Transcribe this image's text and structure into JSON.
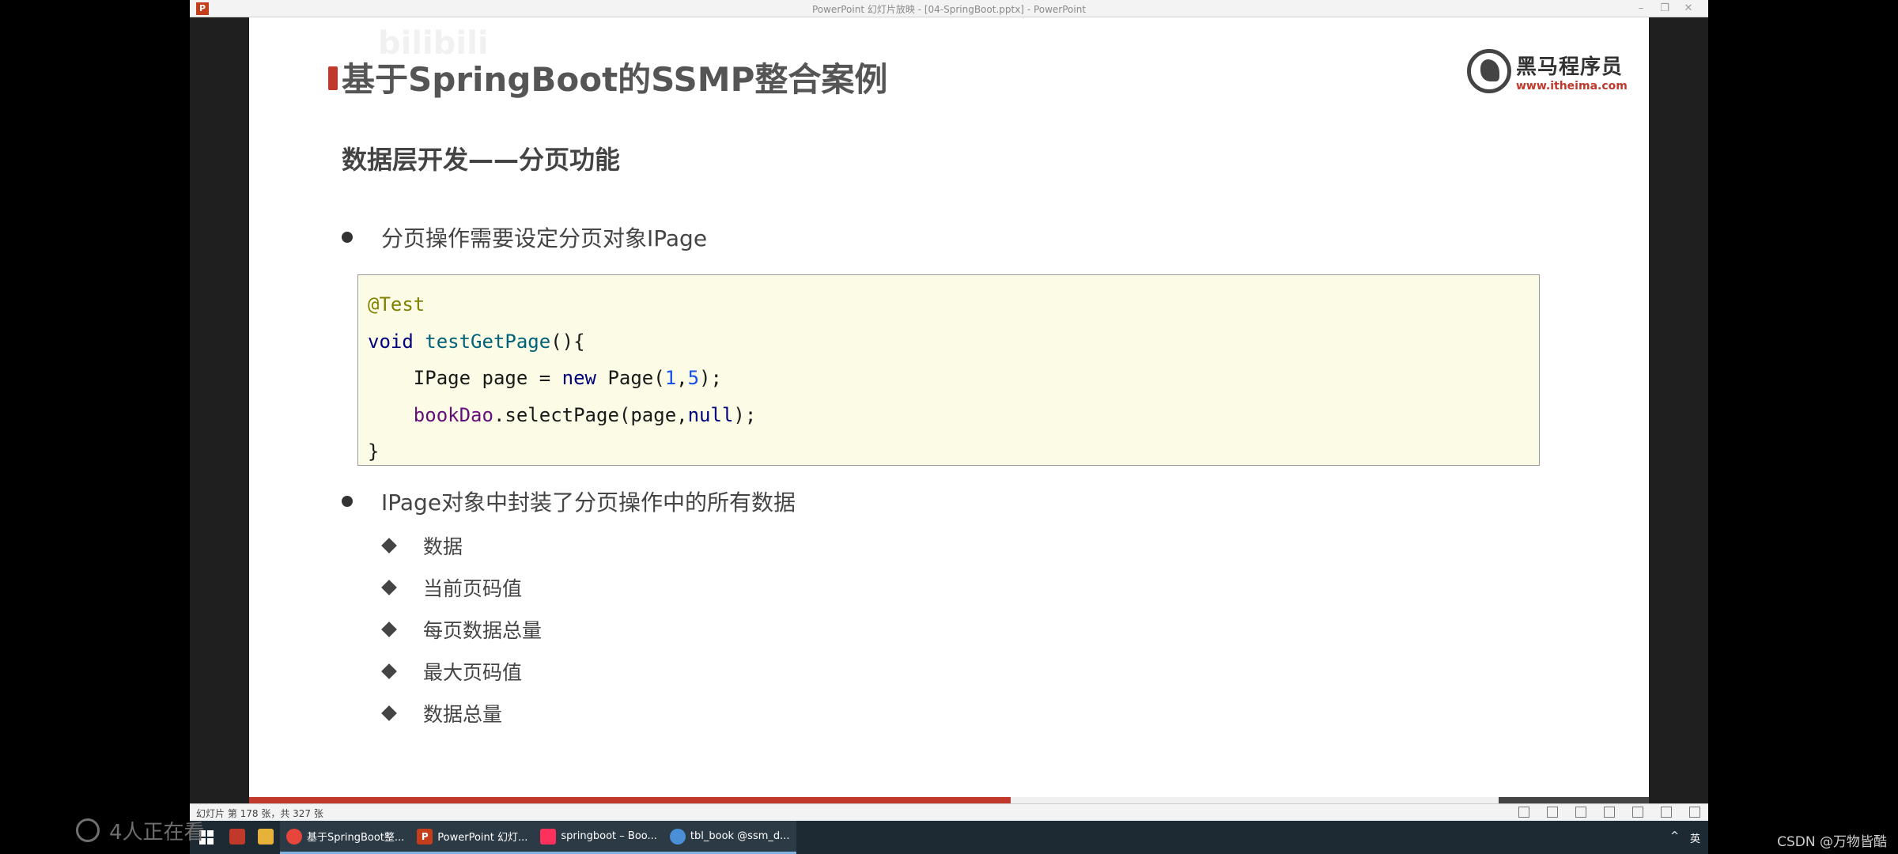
{
  "window": {
    "title": "PowerPoint 幻灯片放映 - [04-SpringBoot.pptx] - PowerPoint",
    "app_icon": "P"
  },
  "slide": {
    "left_logo_char": "黑",
    "bg_watermark": "bilibili",
    "title": "基于SpringBoot的SSMP整合案例",
    "logo": {
      "name": "黑马程序员",
      "url": "www.itheima.com"
    },
    "subtitle": "数据层开发——分页功能",
    "bullet1": "分页操作需要设定分页对象IPage",
    "code": {
      "annotation": "@Test",
      "kw_void": "void",
      "method": "testGetPage",
      "l2_type": "IPage page = ",
      "kw_new": "new",
      "l2_cls": " Page(",
      "n1": "1",
      "comma": ",",
      "n2": "5",
      "l2_end": ");",
      "field": "bookDao",
      "l3_call": ".selectPage(page,",
      "kw_null": "null",
      "l3_end": ");",
      "close": "}"
    },
    "bullet2": "IPage对象中封装了分页操作中的所有数据",
    "sub_items": [
      "数据",
      "当前页码值",
      "每页数据总量",
      "最大页码值",
      "数据总量"
    ],
    "progress_fraction": 0.544
  },
  "statusbar": {
    "text": "幻灯片 第 178 张，共 327 张"
  },
  "taskbar": {
    "items": [
      {
        "label": "基于SpringBoot整...",
        "icon": "chrome-icon",
        "color": "#e8453c"
      },
      {
        "label": "PowerPoint 幻灯...",
        "icon": "powerpoint-icon",
        "color": "#c43e1c"
      },
      {
        "label": "springboot – Boo...",
        "icon": "intellij-icon",
        "color": "#fe315d"
      },
      {
        "label": "tbl_book @ssm_d...",
        "icon": "database-icon",
        "color": "#4a90d9"
      }
    ],
    "tray_caret": "^",
    "tray_lang": "英"
  },
  "overlay": {
    "viewers": "4人正在看",
    "watermark": "CSDN @万物皆酷"
  }
}
